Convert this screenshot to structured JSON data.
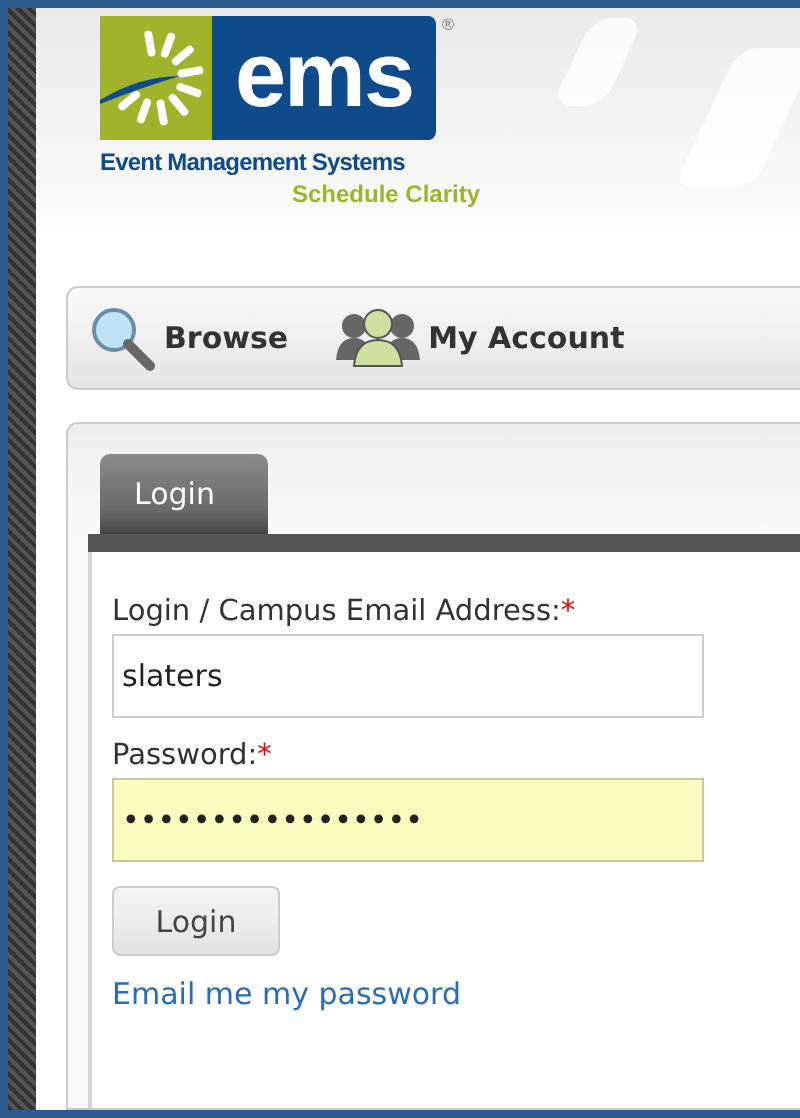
{
  "logo": {
    "wordmark": "ems",
    "registered": "®",
    "company": "Event Management Systems",
    "tagline": "Schedule Clarity"
  },
  "nav": [
    {
      "kind": "browse",
      "label": "Browse"
    },
    {
      "kind": "account",
      "label": "My Account"
    }
  ],
  "tabs": [
    {
      "label": "Login",
      "selected": true
    }
  ],
  "form": {
    "fields": [
      {
        "label": "Login / Campus Email Address:",
        "required_mark": "*",
        "value": "slaters",
        "autofilled": false
      },
      {
        "label": "Password:",
        "required_mark": "*",
        "value": "•••••••••••••••••",
        "autofilled": true
      }
    ],
    "button": "Login",
    "link": "Email me my password"
  }
}
